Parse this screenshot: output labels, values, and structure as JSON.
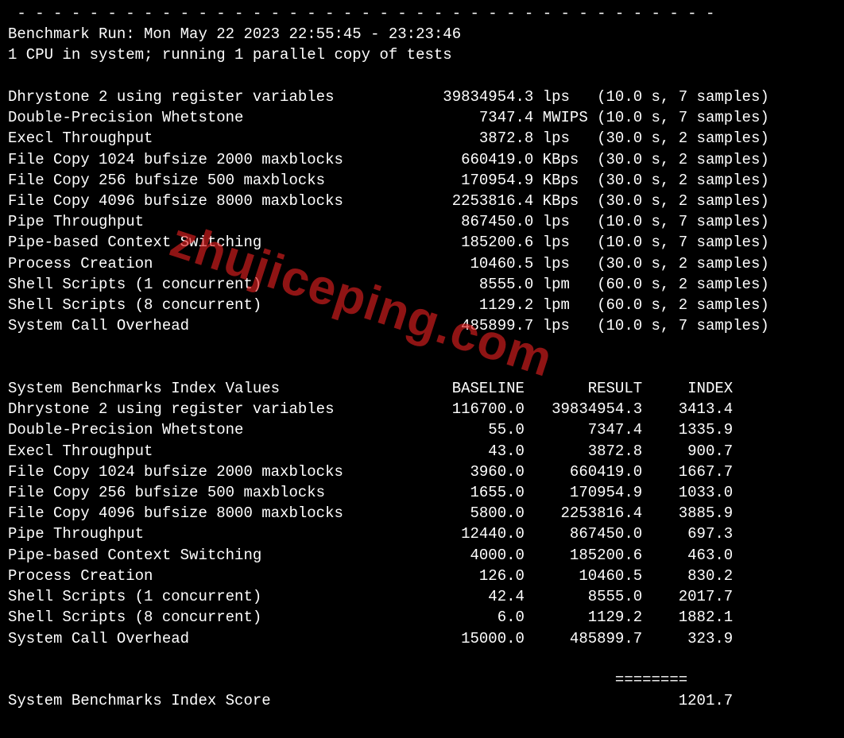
{
  "header": {
    "dashes": " - - - - - - - - - - - - - - - - - - - - - - - - - - - - - - - - - - - - - - -",
    "run": "Benchmark Run: Mon May 22 2023 22:55:45 - 23:23:46",
    "cpu": "1 CPU in system; running 1 parallel copy of tests"
  },
  "tests": [
    {
      "name": "Dhrystone 2 using register variables",
      "value": "39834954.3",
      "unit": "lps",
      "timing": "(10.0 s, 7 samples)"
    },
    {
      "name": "Double-Precision Whetstone",
      "value": "7347.4",
      "unit": "MWIPS",
      "timing": "(10.0 s, 7 samples)"
    },
    {
      "name": "Execl Throughput",
      "value": "3872.8",
      "unit": "lps",
      "timing": "(30.0 s, 2 samples)"
    },
    {
      "name": "File Copy 1024 bufsize 2000 maxblocks",
      "value": "660419.0",
      "unit": "KBps",
      "timing": "(30.0 s, 2 samples)"
    },
    {
      "name": "File Copy 256 bufsize 500 maxblocks",
      "value": "170954.9",
      "unit": "KBps",
      "timing": "(30.0 s, 2 samples)"
    },
    {
      "name": "File Copy 4096 bufsize 8000 maxblocks",
      "value": "2253816.4",
      "unit": "KBps",
      "timing": "(30.0 s, 2 samples)"
    },
    {
      "name": "Pipe Throughput",
      "value": "867450.0",
      "unit": "lps",
      "timing": "(10.0 s, 7 samples)"
    },
    {
      "name": "Pipe-based Context Switching",
      "value": "185200.6",
      "unit": "lps",
      "timing": "(10.0 s, 7 samples)"
    },
    {
      "name": "Process Creation",
      "value": "10460.5",
      "unit": "lps",
      "timing": "(30.0 s, 2 samples)"
    },
    {
      "name": "Shell Scripts (1 concurrent)",
      "value": "8555.0",
      "unit": "lpm",
      "timing": "(60.0 s, 2 samples)"
    },
    {
      "name": "Shell Scripts (8 concurrent)",
      "value": "1129.2",
      "unit": "lpm",
      "timing": "(60.0 s, 2 samples)"
    },
    {
      "name": "System Call Overhead",
      "value": "485899.7",
      "unit": "lps",
      "timing": "(10.0 s, 7 samples)"
    }
  ],
  "index_header": {
    "title": "System Benchmarks Index Values",
    "col1": "BASELINE",
    "col2": "RESULT",
    "col3": "INDEX"
  },
  "index": [
    {
      "name": "Dhrystone 2 using register variables",
      "baseline": "116700.0",
      "result": "39834954.3",
      "index": "3413.4"
    },
    {
      "name": "Double-Precision Whetstone",
      "baseline": "55.0",
      "result": "7347.4",
      "index": "1335.9"
    },
    {
      "name": "Execl Throughput",
      "baseline": "43.0",
      "result": "3872.8",
      "index": "900.7"
    },
    {
      "name": "File Copy 1024 bufsize 2000 maxblocks",
      "baseline": "3960.0",
      "result": "660419.0",
      "index": "1667.7"
    },
    {
      "name": "File Copy 256 bufsize 500 maxblocks",
      "baseline": "1655.0",
      "result": "170954.9",
      "index": "1033.0"
    },
    {
      "name": "File Copy 4096 bufsize 8000 maxblocks",
      "baseline": "5800.0",
      "result": "2253816.4",
      "index": "3885.9"
    },
    {
      "name": "Pipe Throughput",
      "baseline": "12440.0",
      "result": "867450.0",
      "index": "697.3"
    },
    {
      "name": "Pipe-based Context Switching",
      "baseline": "4000.0",
      "result": "185200.6",
      "index": "463.0"
    },
    {
      "name": "Process Creation",
      "baseline": "126.0",
      "result": "10460.5",
      "index": "830.2"
    },
    {
      "name": "Shell Scripts (1 concurrent)",
      "baseline": "42.4",
      "result": "8555.0",
      "index": "2017.7"
    },
    {
      "name": "Shell Scripts (8 concurrent)",
      "baseline": "6.0",
      "result": "1129.2",
      "index": "1882.1"
    },
    {
      "name": "System Call Overhead",
      "baseline": "15000.0",
      "result": "485899.7",
      "index": "323.9"
    }
  ],
  "footer": {
    "sep": "                                                                   ========",
    "label": "System Benchmarks Index Score",
    "score": "1201.7"
  },
  "watermark": "zhujiceping.com"
}
